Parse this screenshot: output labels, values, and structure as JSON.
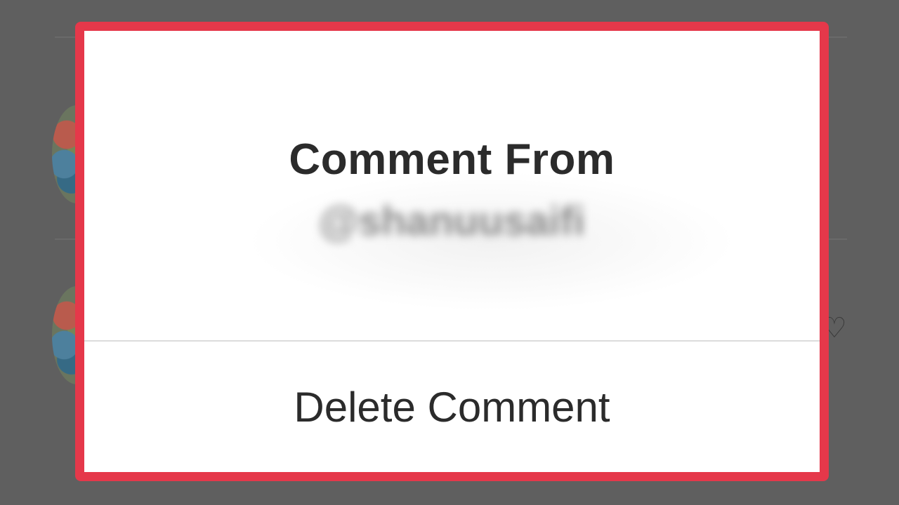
{
  "dialog": {
    "title": "Comment From",
    "username": "@shanuusaifi",
    "actions": [
      {
        "label": "Delete Comment"
      }
    ]
  },
  "background": {
    "heart_icon": "heart-outline-icon"
  },
  "colors": {
    "highlight_border": "#e5384a",
    "overlay": "#5f5f5f",
    "dialog_bg": "#ffffff",
    "text": "#2b2b2b"
  }
}
